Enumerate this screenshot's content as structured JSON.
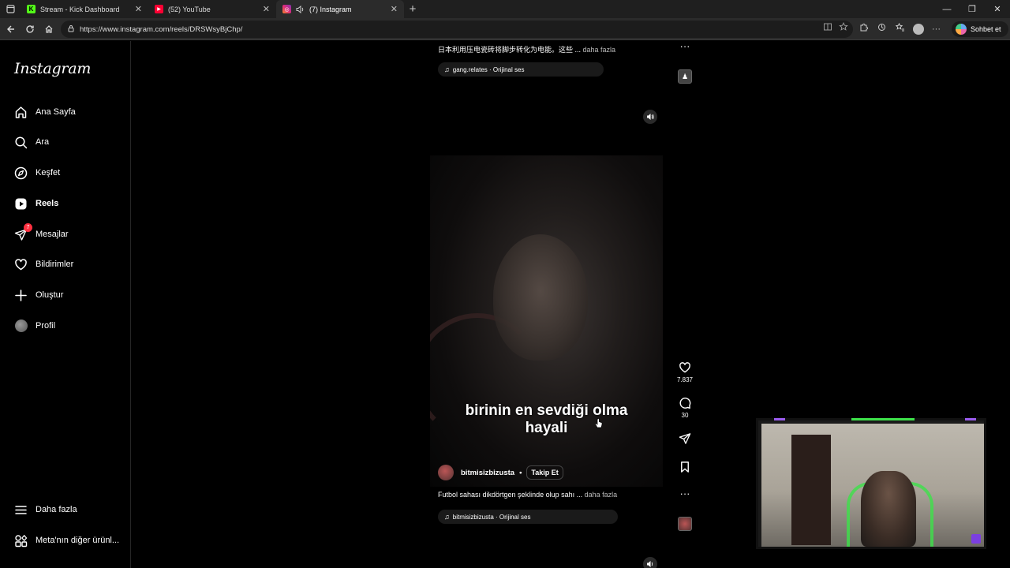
{
  "browser": {
    "tabs": [
      {
        "title": "Stream - Kick Dashboard",
        "favicon": "K",
        "favicon_color": "#53fc18",
        "active": false
      },
      {
        "title": "(52) YouTube",
        "favicon": "▶",
        "favicon_color": "#ff0033",
        "active": false
      },
      {
        "title": "(7) Instagram",
        "favicon": "◎",
        "favicon_color": "#e1306c",
        "active": true
      }
    ],
    "url": "https://www.instagram.com/reels/DRSWsyBjChp/",
    "copilot_label": "Sohbet et"
  },
  "sidebar": {
    "logo": "Instagram",
    "items": [
      {
        "label": "Ana Sayfa",
        "icon": "home-icon"
      },
      {
        "label": "Ara",
        "icon": "search-icon"
      },
      {
        "label": "Keşfet",
        "icon": "explore-icon"
      },
      {
        "label": "Reels",
        "icon": "reels-icon"
      },
      {
        "label": "Mesajlar",
        "icon": "messages-icon",
        "badge": "7"
      },
      {
        "label": "Bildirimler",
        "icon": "heart-icon"
      },
      {
        "label": "Oluştur",
        "icon": "plus-icon"
      },
      {
        "label": "Profil",
        "icon": "profile-avatar"
      }
    ],
    "bottom_items": [
      {
        "label": "Daha fazla",
        "icon": "menu-icon"
      },
      {
        "label": "Meta'nın diğer ürünl...",
        "icon": "meta-apps-icon"
      }
    ]
  },
  "previous_reel": {
    "caption": "日本利用压电瓷砖将脚步转化为电能。这些 ...",
    "more_label": "daha fazla",
    "audio": "gang.relates · Orijinal ses"
  },
  "reel": {
    "subtitle_line1": "birinin en sevdiği olma",
    "subtitle_line2": "hayali",
    "author": "bitmisizbizusta",
    "dot": "•",
    "follow_label": "Takip Et",
    "caption": "Futbol sahası dikdörtgen şeklinde olup sahı ...",
    "more_label": "daha fazla",
    "audio": "bitmisizbizusta · Orijinal ses",
    "likes": "7.837",
    "comments": "30"
  },
  "colors": {
    "accent_green": "#3de24a",
    "accent_purple": "#9b5cf0",
    "badge_red": "#ff3040"
  }
}
